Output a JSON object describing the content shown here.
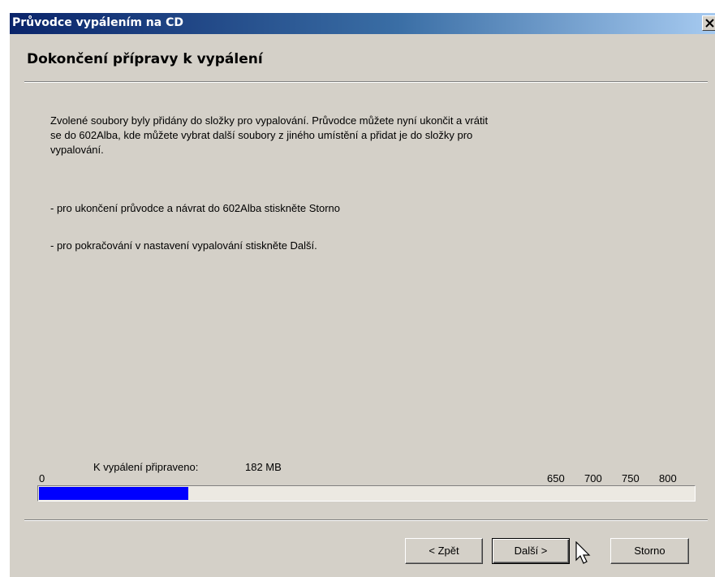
{
  "window": {
    "title": "Průvodce vypálením na CD",
    "close_glyph": "✕"
  },
  "header": {
    "title": "Dokončení přípravy k vypálení"
  },
  "content": {
    "paragraph_lines": [
      "Zvolené soubory byly přidány do složky pro vypalování. Průvodce můžete nyní ukončit a vrátit",
      "se do 602Alba, kde můžete vybrat další soubory z jiného umístění a přidat je do složky pro",
      "vypalování."
    ],
    "option_cancel": "- pro ukončení průvodce a návrat do 602Alba stiskněte Storno",
    "option_next": "- pro pokračování v nastavení vypalování stiskněte Další."
  },
  "capacity": {
    "ready_label": "K vypálení připraveno:",
    "ready_value": "182  MB",
    "scale_zero": "0",
    "scale_marks": [
      "650",
      "700",
      "750",
      "800"
    ],
    "used_mb": 182,
    "max_mb": 800,
    "fill_color": "#0000ff"
  },
  "buttons": {
    "back": "< Zpět",
    "next": "Další >",
    "cancel": "Storno"
  }
}
